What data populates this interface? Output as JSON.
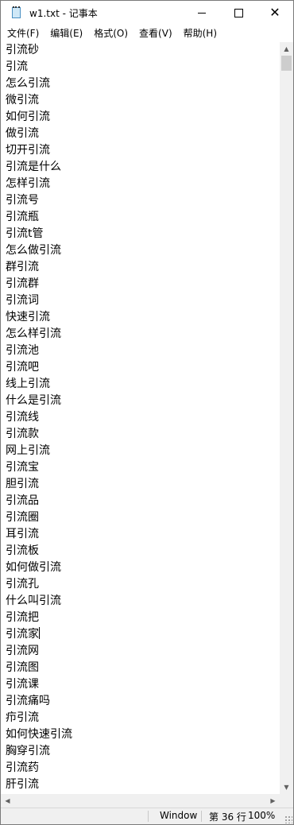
{
  "window": {
    "title": "w1.txt - 记事本",
    "minimize_glyph": "",
    "close_glyph": "✕"
  },
  "menu": [
    {
      "label": "文件(F)"
    },
    {
      "label": "编辑(E)"
    },
    {
      "label": "格式(O)"
    },
    {
      "label": "查看(V)"
    },
    {
      "label": "帮助(H)"
    }
  ],
  "editor": {
    "lines": [
      "引流砂",
      "引流",
      "怎么引流",
      "微引流",
      "如何引流",
      "做引流",
      "切开引流",
      "引流是什么",
      "怎样引流",
      "引流号",
      "引流瓶",
      "引流t管",
      "怎么做引流",
      "群引流",
      "引流群",
      "引流词",
      "快速引流",
      "怎么样引流",
      "引流池",
      "引流吧",
      "线上引流",
      "什么是引流",
      "引流线",
      "引流款",
      "网上引流",
      "引流宝",
      "胆引流",
      "引流品",
      "引流圈",
      "耳引流",
      "引流板",
      "如何做引流",
      "引流孔",
      "什么叫引流",
      "引流把",
      "引流家",
      "引流网",
      "引流图",
      "引流课",
      "引流痛吗",
      "疖引流",
      "如何快速引流",
      "胸穿引流",
      "引流药",
      "肝引流"
    ],
    "caret_line": 36
  },
  "scrollbars": {
    "up_arrow": "▲",
    "down_arrow": "▼",
    "left_arrow": "◀",
    "right_arrow": "▶"
  },
  "status": {
    "line_ending": "Windows (CRLF)",
    "position": "第 36 行",
    "zoom": "100%"
  }
}
